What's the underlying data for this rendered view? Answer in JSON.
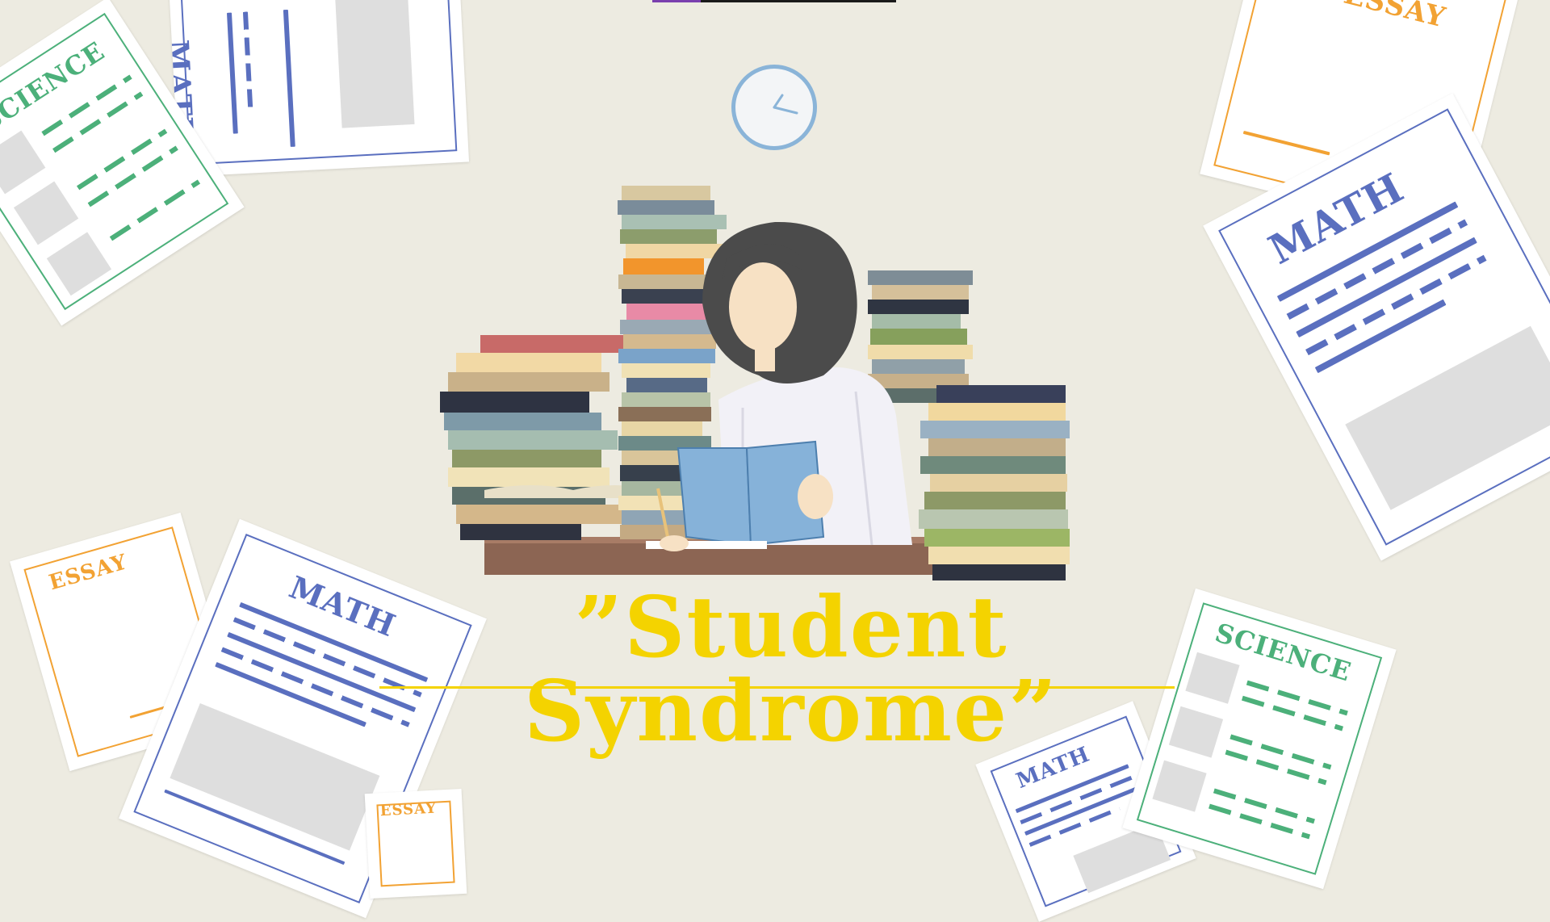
{
  "title": "”Student Syndrome”",
  "colors": {
    "background": "#edebe1",
    "title": "#f4d300",
    "math": "#5a6fbf",
    "science": "#4cb07a",
    "essay": "#f2a233"
  },
  "papers": {
    "science_top_left": "SCIENCE",
    "math_top_left": "MATH",
    "essay_top_right": "ESSAY",
    "math_right": "MATH",
    "essay_bottom_left": "ESSAY",
    "math_bottom_left": "MATH",
    "essay_bottom_small": "ESSAY",
    "math_bottom_right": "MATH",
    "science_bottom_right": "SCIENCE"
  },
  "icons": {
    "clock": "wall-clock-icon",
    "illustration": "student-studying-illustration"
  }
}
